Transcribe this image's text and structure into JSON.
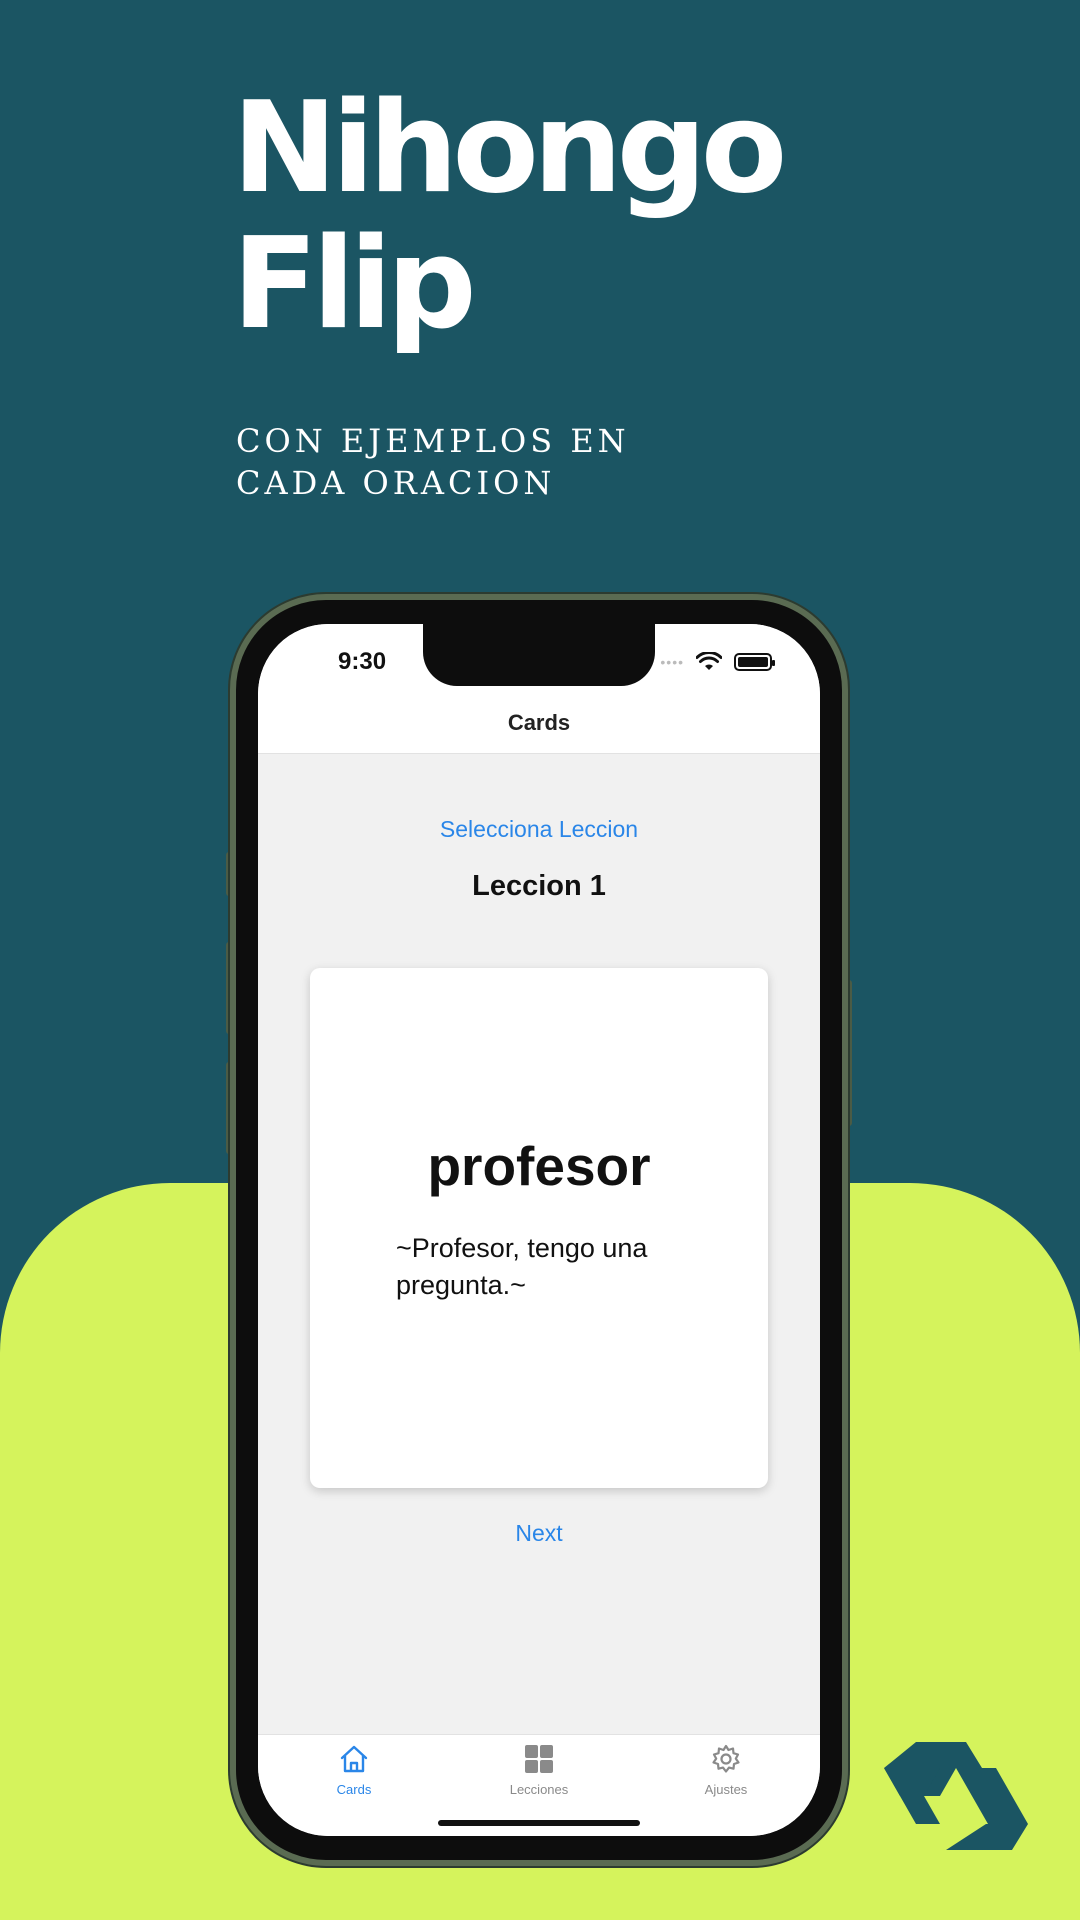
{
  "hero": {
    "title_line1": "Nihongo",
    "title_line2": "Flip",
    "subtitle": "CON EJEMPLOS EN CADA ORACION"
  },
  "status_bar": {
    "time": "9:30"
  },
  "nav": {
    "title": "Cards"
  },
  "content": {
    "select_lesson_label": "Selecciona Leccion",
    "lesson_title": "Leccion 1",
    "next_label": "Next"
  },
  "card": {
    "word": "profesor",
    "example": "~Profesor, tengo una pregunta.~"
  },
  "tabs": [
    {
      "label": "Cards",
      "icon": "house-icon",
      "active": true
    },
    {
      "label": "Lecciones",
      "icon": "grid-icon",
      "active": false
    },
    {
      "label": "Ajustes",
      "icon": "gear-icon",
      "active": false
    }
  ],
  "colors": {
    "background_teal": "#1b5563",
    "accent_lime": "#d5f35c",
    "link_blue": "#2a86e8"
  }
}
